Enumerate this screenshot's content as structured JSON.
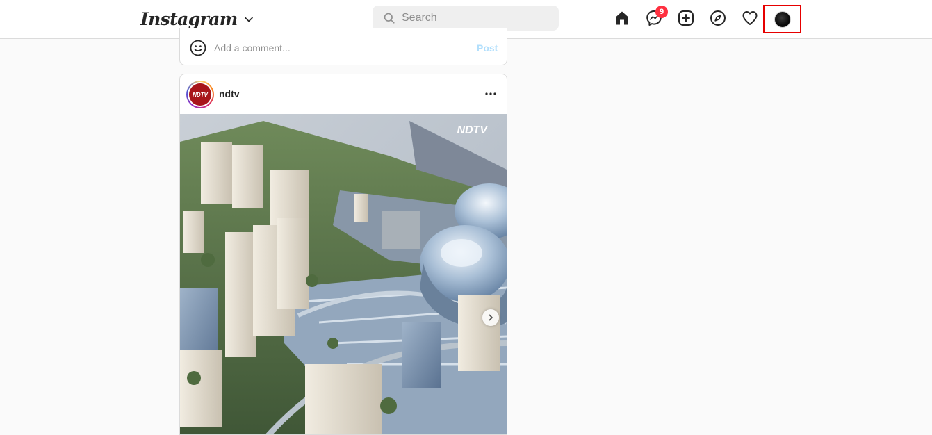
{
  "app": {
    "logo_text": "Instagram"
  },
  "search": {
    "placeholder": "Search"
  },
  "nav": {
    "icons": [
      "home-icon",
      "messenger-icon",
      "new-post-icon",
      "explore-icon",
      "activity-heart-icon",
      "profile-avatar"
    ],
    "messenger_badge": "9"
  },
  "comment_box": {
    "placeholder": "Add a comment...",
    "post_label": "Post"
  },
  "post": {
    "username": "ndtv",
    "avatar_text": "NDTV",
    "image_watermark": "NDTV"
  },
  "colors": {
    "badge": "#ff3040",
    "post_button_disabled": "#b2dffc",
    "highlight": "#e60000",
    "ndtv_red": "#a8151a"
  }
}
